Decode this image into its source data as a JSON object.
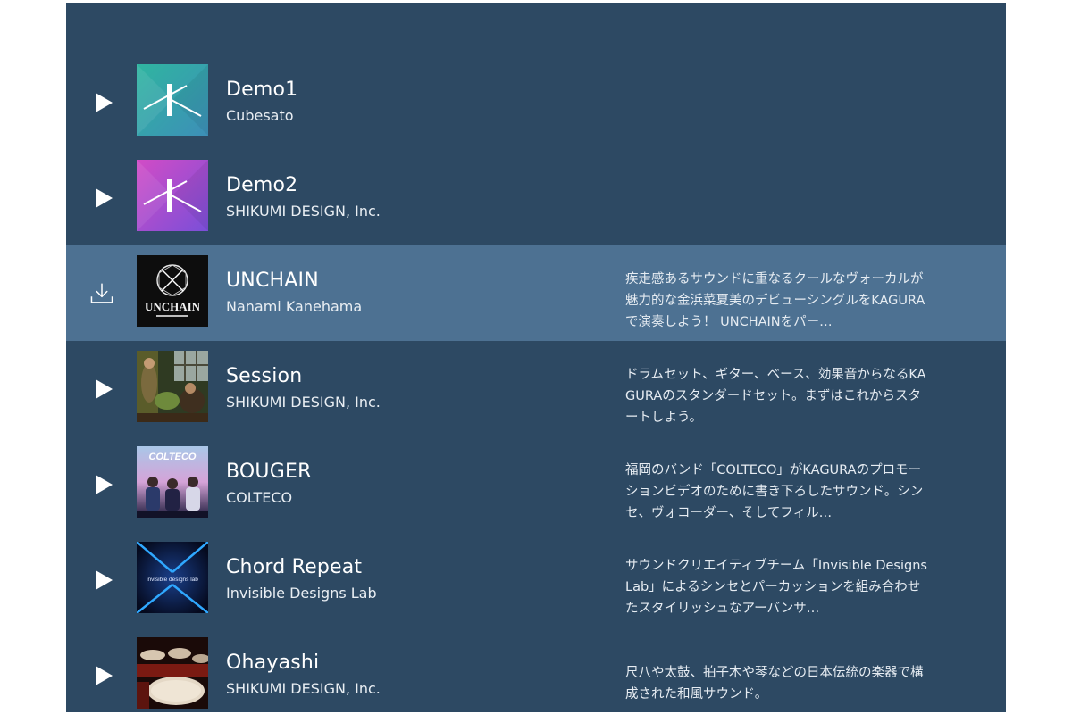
{
  "tracks": [
    {
      "title": "Demo1",
      "artist": "Cubesato",
      "description": "",
      "action_icon": "play-icon",
      "selected": false
    },
    {
      "title": "Demo2",
      "artist": "SHIKUMI DESIGN, Inc.",
      "description": "",
      "action_icon": "play-icon",
      "selected": false
    },
    {
      "title": "UNCHAIN",
      "artist": "Nanami Kanehama",
      "description": "疾走感あるサウンドに重なるクールなヴォーカルが魅力的な金浜菜夏美のデビューシングルをKAGURAで演奏しよう！ UNCHAINをパー…",
      "action_icon": "download-icon",
      "selected": true,
      "thumb_text": "UNCHAIN"
    },
    {
      "title": "Session",
      "artist": "SHIKUMI DESIGN, Inc.",
      "description": "ドラムセット、ギター、ベース、効果音からなるKAGURAのスタンダードセット。まずはこれからスタートしよう。",
      "action_icon": "play-icon",
      "selected": false
    },
    {
      "title": "BOUGER",
      "artist": "COLTECO",
      "description": "福岡のバンド「COLTECO」がKAGURAのプロモーションビデオのために書き下ろしたサウンド。シンセ、ヴォコーダー、そしてフィル…",
      "action_icon": "play-icon",
      "selected": false,
      "thumb_text": "COLTECO"
    },
    {
      "title": "Chord Repeat",
      "artist": "Invisible Designs Lab",
      "description": "サウンドクリエイティブチーム「Invisible Designs Lab」によるシンセとパーカッションを組み合わせたスタイリッシュなアーバンサ…",
      "action_icon": "play-icon",
      "selected": false,
      "thumb_text": "invisible designs lab"
    },
    {
      "title": "Ohayashi",
      "artist": "SHIKUMI DESIGN, Inc.",
      "description": "尺八や太鼓、拍子木や琴などの日本伝統の楽器で構成された和風サウンド。",
      "action_icon": "play-icon",
      "selected": false
    }
  ],
  "colors": {
    "panel_bg": "#2d4963",
    "selected_bg": "#4d7192",
    "text": "#ffffff"
  }
}
